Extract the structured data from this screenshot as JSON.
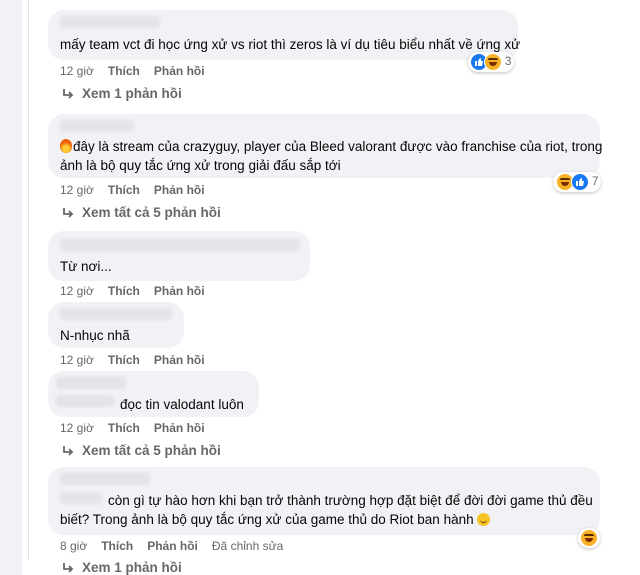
{
  "colors": {
    "bubble": "#f0f2f5",
    "meta": "#65676b",
    "like": "#1877f2",
    "haha": "#f7b125"
  },
  "comments": [
    {
      "lines": [
        "mấy team vct đi học ứng xử vs riot thì zeros là ví dụ tiêu biểu nhất về ứng xử"
      ],
      "time": "12 giờ",
      "like": "Thích",
      "reply": "Phản hồi",
      "reactions": {
        "icons": [
          "like-icon",
          "haha-icon"
        ],
        "count": "3"
      },
      "replies_link": "Xem 1 phản hồi"
    },
    {
      "lines": [
        "đây là stream của crazyguy, player của Bleed valorant được vào franchise của riot, trong",
        "ảnh là bộ quy tắc ứng xử trong giải đấu sắp tới"
      ],
      "time": "12 giờ",
      "like": "Thích",
      "reply": "Phản hồi",
      "reactions": {
        "icons": [
          "haha-icon",
          "like-icon"
        ],
        "count": "7"
      },
      "replies_link": "Xem tất cả 5 phản hồi"
    },
    {
      "lines": [
        "Từ nơi..."
      ],
      "time": "12 giờ",
      "like": "Thích",
      "reply": "Phản hồi"
    },
    {
      "lines": [
        "N-nhục nhã"
      ],
      "time": "12 giờ",
      "like": "Thích",
      "reply": "Phản hồi"
    },
    {
      "lines": [
        "đọc tin valodant luôn"
      ],
      "time": "12 giờ",
      "like": "Thích",
      "reply": "Phản hồi",
      "replies_link": "Xem tất cả 5 phản hồi"
    },
    {
      "lines": [
        "còn gì tự hào hơn khi bạn trở thành trường hợp đặt biệt để đời đời game thủ đều",
        "biết? Trong ảnh là bộ quy tắc ứng xử của game thủ do Riot ban hành"
      ],
      "time": "8 giờ",
      "like": "Thích",
      "reply": "Phản hồi",
      "edited": "Đã chỉnh sửa",
      "reactions": {
        "icons": [
          "haha-icon"
        ],
        "count": ""
      },
      "replies_link": "Xem 1 phản hồi"
    }
  ]
}
